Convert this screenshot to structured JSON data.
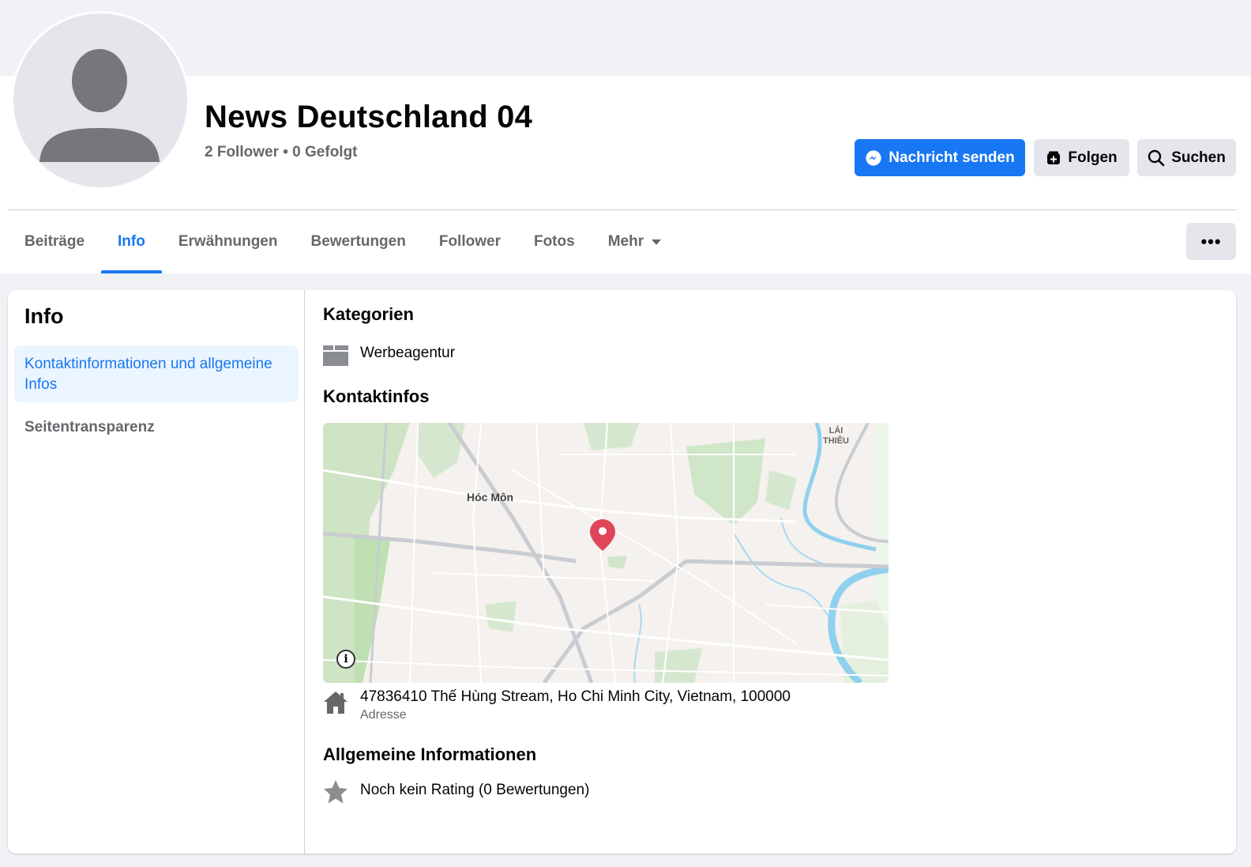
{
  "profile": {
    "name": "News Deutschland 04",
    "stats": "2 Follower • 0 Gefolgt"
  },
  "actions": {
    "message": "Nachricht senden",
    "follow": "Folgen",
    "search": "Suchen",
    "more": "•••"
  },
  "tabs": [
    {
      "label": "Beiträge",
      "active": false
    },
    {
      "label": "Info",
      "active": true
    },
    {
      "label": "Erwähnungen",
      "active": false
    },
    {
      "label": "Bewertungen",
      "active": false
    },
    {
      "label": "Follower",
      "active": false
    },
    {
      "label": "Fotos",
      "active": false
    },
    {
      "label": "Mehr",
      "active": false
    }
  ],
  "sidebar": {
    "title": "Info",
    "items": [
      {
        "label": "Kontaktinformationen und allgemeine Infos",
        "active": true
      },
      {
        "label": "Seitentransparenz",
        "active": false
      }
    ]
  },
  "about": {
    "categories_title": "Kategorien",
    "category": "Werbeagentur",
    "contact_title": "Kontaktinfos",
    "map": {
      "label_city": "Hóc Môn",
      "label_town_line1": "LÁI",
      "label_town_line2": "THIÊU",
      "info": "i"
    },
    "address": "47836410 Thế Hùng Stream, Ho Chi Minh City, Vietnam, 100000",
    "address_label": "Adresse",
    "general_title": "Allgemeine Informationen",
    "rating": "Noch kein Rating (0 Bewertungen)"
  },
  "colors": {
    "accent": "#1877f2",
    "pin": "#e0455a",
    "park": "#cfe6c8",
    "water": "#8fd0ee"
  }
}
